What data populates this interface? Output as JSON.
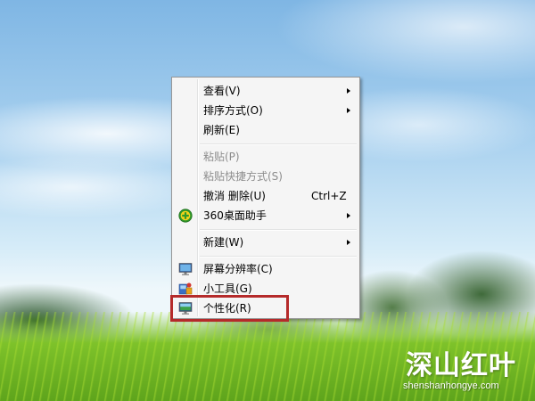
{
  "context_menu": {
    "items": [
      {
        "label": "查看(V)"
      },
      {
        "label": "排序方式(O)"
      },
      {
        "label": "刷新(E)"
      },
      {
        "label": "粘贴(P)"
      },
      {
        "label": "粘贴快捷方式(S)"
      },
      {
        "label": "撤消 删除(U)",
        "shortcut": "Ctrl+Z"
      },
      {
        "label": "360桌面助手",
        "icon": "360-plus-icon"
      },
      {
        "label": "新建(W)"
      },
      {
        "label": "屏幕分辨率(C)",
        "icon": "monitor-icon"
      },
      {
        "label": "小工具(G)",
        "icon": "gadgets-icon"
      },
      {
        "label": "个性化(R)",
        "icon": "personalize-icon"
      }
    ],
    "highlighted_item": "个性化(R)",
    "highlight_color": "#b52a2a"
  },
  "watermark": {
    "title": "深山红叶",
    "url": "shenshanhongye.com"
  }
}
